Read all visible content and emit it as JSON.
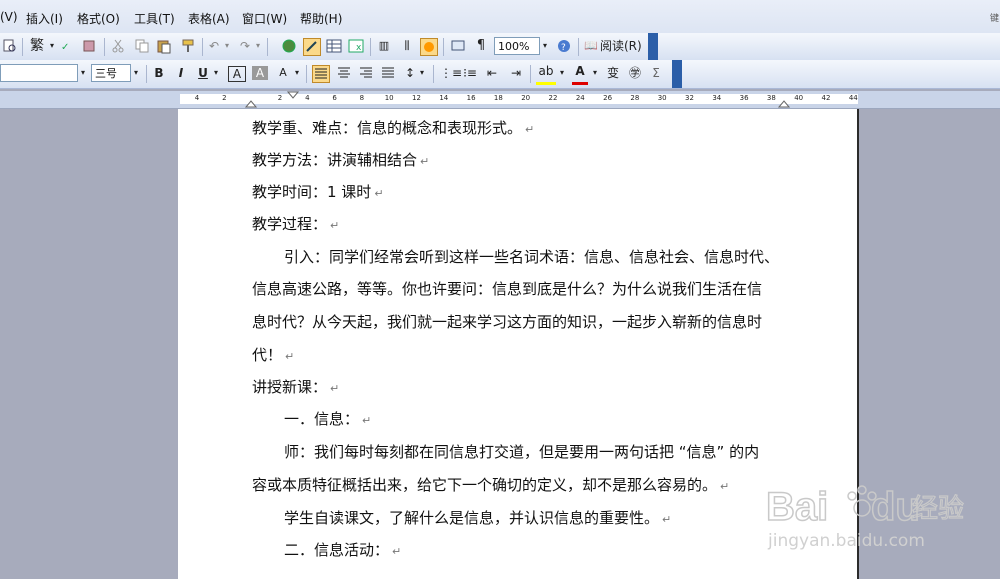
{
  "menu": {
    "items": [
      "(V)",
      "插入(I)",
      "格式(O)",
      "工具(T)",
      "表格(A)",
      "窗口(W)",
      "帮助(H)"
    ],
    "right_hint": "键"
  },
  "toolbar1": {
    "trad_label": "繁",
    "zoom": "100%",
    "read_label": "阅读(R)"
  },
  "toolbar2": {
    "size_value": "三号",
    "bold": "B",
    "italic": "I",
    "underline": "U",
    "sigma": "Σ"
  },
  "ruler": {
    "ticks": [
      "4",
      "2",
      "2",
      "4",
      "6",
      "8",
      "10",
      "12",
      "14",
      "16",
      "18",
      "20",
      "22",
      "24",
      "26",
      "28",
      "30",
      "32",
      "34",
      "36",
      "38",
      "40",
      "42",
      "44"
    ]
  },
  "document": {
    "lines": [
      "教学重、难点：信息的概念和表现形式。",
      "教学方法：讲演辅相结合",
      "教学时间：1 课时",
      "教学过程：",
      "引入：同学们经常会听到这样一些名词术语：信息、信息社会、信息时代、",
      "信息高速公路，等等。你也许要问：信息到底是什么？为什么说我们生活在信",
      "息时代？从今天起，我们就一起来学习这方面的知识，一起步入崭新的信息时",
      "代！",
      "讲授新课：",
      "一．信息：",
      "师：我们每时每刻都在同信息打交道，但是要用一两句话把 “信息” 的内",
      "容或本质特征概括出来，给它下一个确切的定义，却不是那么容易的。",
      "学生自读课文，了解什么是信息，并认识信息的重要性。",
      "二．信息活动："
    ]
  },
  "watermark": {
    "brand": "Bai",
    "brand2": "du",
    "cn": "经验",
    "url": "jingyan.baidu.com"
  },
  "colors": {
    "toolbar_bg": "#dde5f3",
    "workspace": "#a7abbc",
    "accent": "#2b5ea8"
  }
}
